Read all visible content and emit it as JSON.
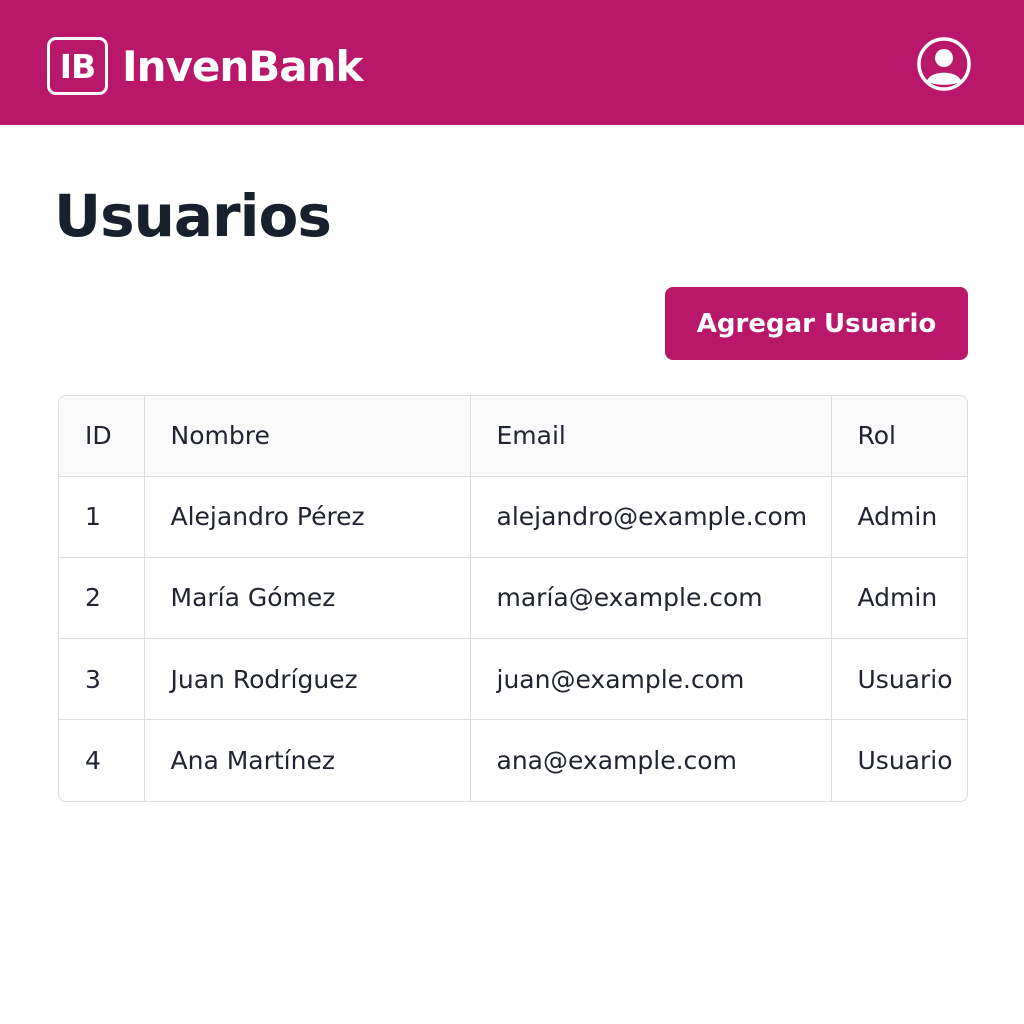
{
  "app": {
    "logo_mark": "IB",
    "name": "InvenBank"
  },
  "header": {
    "profile_icon": "user-circle-icon"
  },
  "page": {
    "title": "Usuarios",
    "add_button_label": "Agregar Usuario"
  },
  "table": {
    "columns": [
      "ID",
      "Nombre",
      "Email",
      "Rol"
    ],
    "rows": [
      [
        "1",
        "Alejandro Pérez",
        "alejandro@example.com",
        "Admin"
      ],
      [
        "2",
        "María Gómez",
        "maría@example.com",
        "Admin"
      ],
      [
        "3",
        "Juan Rodríguez",
        "juan@example.com",
        "Usuario"
      ],
      [
        "4",
        "Ana Martínez",
        "ana@example.com",
        "Usuario"
      ]
    ]
  },
  "colors": {
    "brand": "#b8176a",
    "text": "#17202c",
    "border": "#dcdde1"
  }
}
